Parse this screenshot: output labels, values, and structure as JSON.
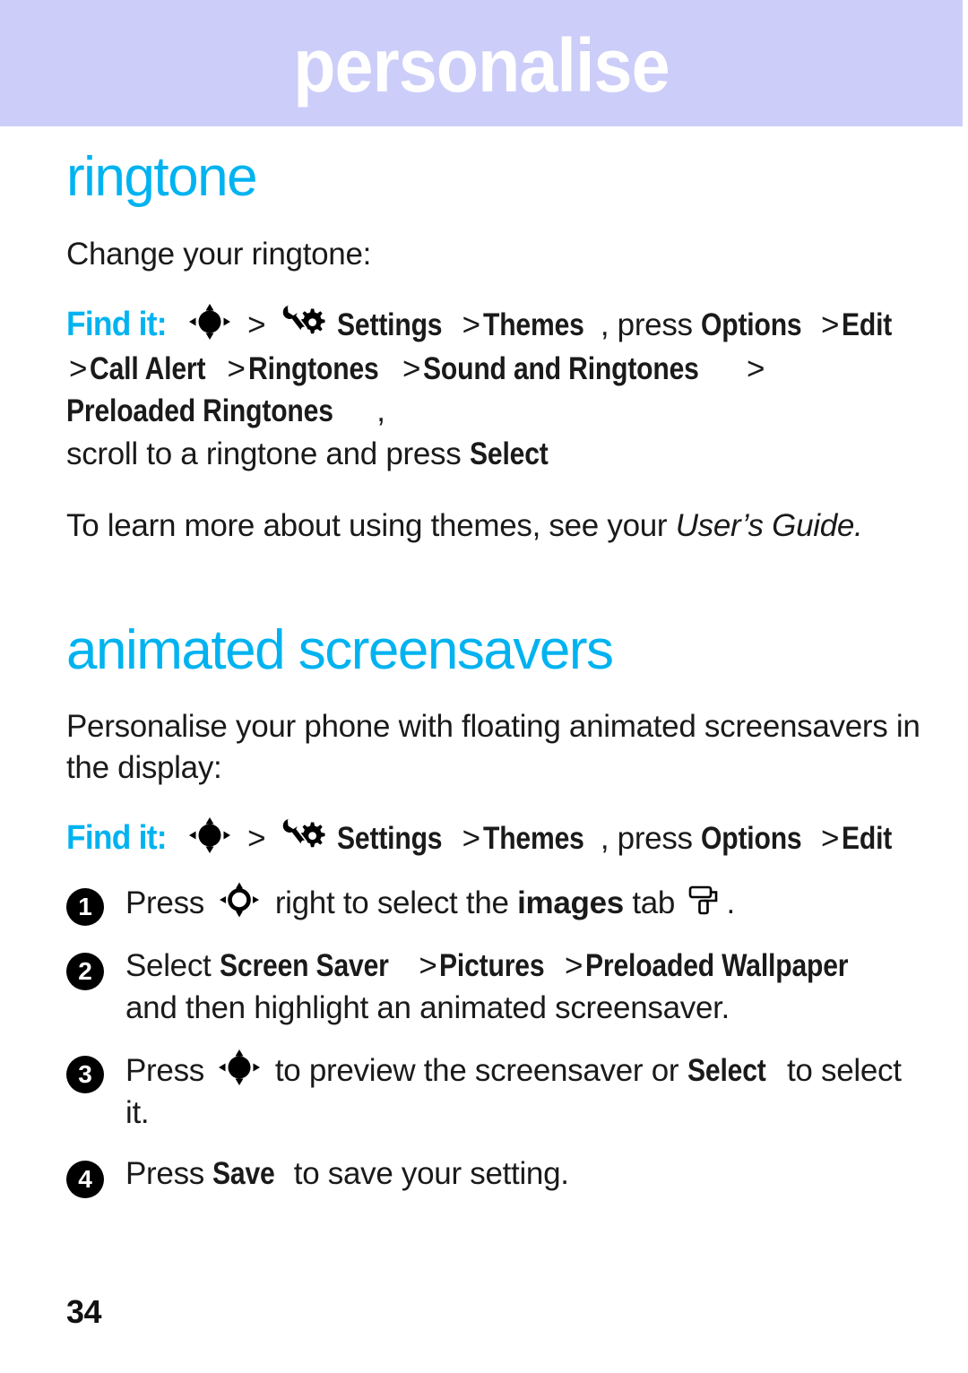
{
  "header": {
    "title": "personalise",
    "band_color": "#ccceF9",
    "title_color": "#ffffff"
  },
  "accent_color": "#00B3F0",
  "body_color": "#1a1a1a",
  "sections": [
    {
      "id": "ringtone",
      "heading": "ringtone",
      "intro": "Change your ringtone:",
      "findit": {
        "label": "Find it:",
        "icon_1": "navigation-key-filled-icon",
        "sep_1": ">",
        "icon_2": "settings-wrench-gear-icon",
        "part_1": "Settings",
        "sep_2": ">",
        "part_2": "Themes",
        "part_3": ", press ",
        "part_4": "Options",
        "sep_3": ">",
        "part_5": "Edit",
        "sep_4": ">",
        "part_6": "Call Alert",
        "sep_5": ">",
        "part_7": "Ringtones",
        "sep_6": ">",
        "part_8": "Sound and Ringtones",
        "sep_7": ">",
        "part_9": "Preloaded Ringtones",
        "part_10": ",",
        "tail_plain": "scroll to a ringtone and press ",
        "tail_bold": "Select"
      },
      "note_plain": "To learn more about using themes, see your ",
      "note_italic": "User’s Guide."
    },
    {
      "id": "animated-screensavers",
      "heading": "animated screensavers",
      "intro": "Personalise your phone with floating animated screensavers in the display:",
      "findit": {
        "label": "Find it:",
        "icon_1": "navigation-key-filled-icon",
        "sep_1": ">",
        "icon_2": "settings-wrench-gear-icon",
        "part_1": "Settings",
        "sep_2": ">",
        "part_2": "Themes",
        "part_3": ", press ",
        "part_4": "Options",
        "sep_3": ">",
        "part_5": "Edit"
      },
      "steps": [
        {
          "number": "1",
          "pre": "Press ",
          "icon": "navigation-key-hollow-icon",
          "mid": " right to select the ",
          "bold": "images",
          "post": " tab ",
          "trailing_icon": "paint-roller-images-tab-icon",
          "end": "."
        },
        {
          "number": "2",
          "pre": "Select ",
          "path_1": "Screen Saver",
          "sep_1": ">",
          "path_2": "Pictures",
          "sep_2": ">",
          "path_3": "Preloaded Wallpaper",
          "post": " and then highlight an animated screensaver."
        },
        {
          "number": "3",
          "pre": "Press ",
          "icon": "navigation-key-filled-icon",
          "mid": " to preview the screensaver or ",
          "bold": "Select",
          "post": " to select it."
        },
        {
          "number": "4",
          "pre": "Press ",
          "bold": "Save",
          "post": " to save your setting."
        }
      ]
    }
  ],
  "footer": {
    "page_number": "34"
  }
}
